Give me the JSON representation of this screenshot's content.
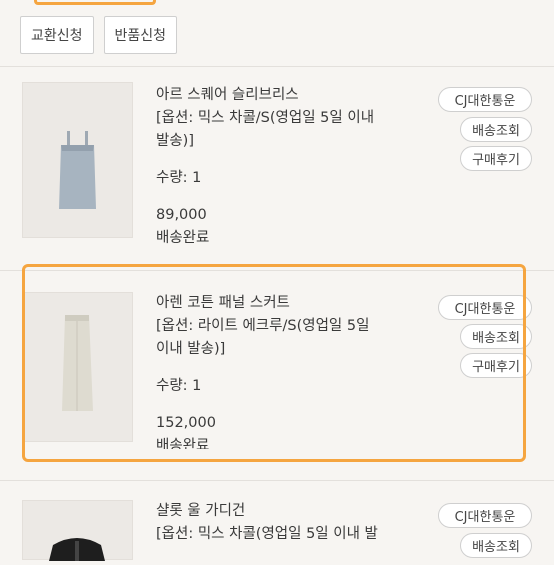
{
  "buttons": {
    "exchange": "교환신청",
    "return": "반품신청"
  },
  "items": [
    {
      "name": "아르 스퀘어 슬리브리스",
      "option1": "[옵션: 믹스 차콜/S(영업일 5일 이내",
      "option2": "발송)]",
      "qty": "수량: 1",
      "price": "89,000",
      "status": "배송완료",
      "courier": "CJ대한통운",
      "track": "배송조회",
      "review": "구매후기"
    },
    {
      "name": "아렌 코튼 패널 스커트",
      "option1": "[옵션: 라이트 에크루/S(영업일 5일",
      "option2": "이내 발송)]",
      "qty": "수량: 1",
      "price": "152,000",
      "status": "배송완료",
      "courier": "CJ대한통운",
      "track": "배송조회",
      "review": "구매후기"
    },
    {
      "name": "샬롯 울 가디건",
      "option1": "[옵션: 믹스 차콜(영업일 5일 이내 발",
      "courier": "CJ대한통운",
      "track": "배송조회"
    }
  ]
}
